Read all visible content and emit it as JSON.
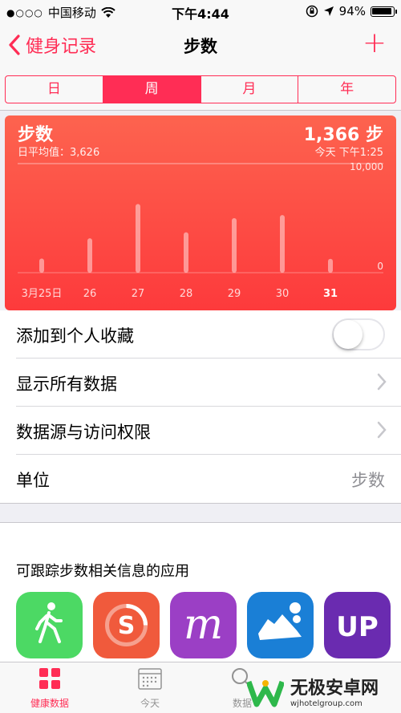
{
  "status_bar": {
    "carrier": "中国移动",
    "time": "下午4:44",
    "battery": "94%"
  },
  "nav": {
    "back_label": "健身记录",
    "title": "步数",
    "add_label": "+"
  },
  "segments": [
    {
      "label": "日",
      "active": false
    },
    {
      "label": "周",
      "active": true
    },
    {
      "label": "月",
      "active": false
    },
    {
      "label": "年",
      "active": false
    }
  ],
  "chart_card": {
    "title": "步数",
    "subtitle": "日平均值：3,626",
    "value": "1,366",
    "value_unit": "步",
    "time": "今天 下午1:25"
  },
  "chart_data": {
    "type": "bar",
    "categories": [
      "3月25日",
      "26",
      "27",
      "28",
      "29",
      "30",
      "31"
    ],
    "values": [
      1400,
      3400,
      6800,
      4000,
      5400,
      5700,
      1366
    ],
    "ylim": [
      0,
      10000
    ],
    "ytick_labels": [
      "10,000",
      "0"
    ],
    "highlight_category": "31",
    "color": "#ffffff"
  },
  "list": {
    "favorite_label": "添加到个人收藏",
    "favorite_on": false,
    "show_all_label": "显示所有数据",
    "sources_label": "数据源与访问权限",
    "unit_label": "单位",
    "unit_value": "步数"
  },
  "apps": {
    "heading": "可跟踪步数相关信息的应用",
    "items": [
      {
        "icon": "walking-figure-icon",
        "color": "#4cd964"
      },
      {
        "icon": "stepz-s-icon",
        "color": "#f05a3c"
      },
      {
        "icon": "moves-m-icon",
        "color": "#9b3fc5"
      },
      {
        "icon": "running-shoe-icon",
        "color": "#1a7fd6"
      },
      {
        "icon": "up-jawbone-icon",
        "color": "#6a2bb0"
      }
    ]
  },
  "tabbar": {
    "tabs": [
      {
        "label": "健康数据",
        "icon": "grid-icon",
        "active": true
      },
      {
        "label": "今天",
        "icon": "calendar-icon",
        "active": false
      },
      {
        "label": "数据",
        "icon": "search-icon",
        "active": false
      }
    ]
  },
  "watermark": {
    "title": "无极安卓网",
    "url": "wjhotelgroup.com"
  },
  "colors": {
    "accent": "#ff2d55",
    "chart_top": "#fd634f",
    "chart_bottom": "#fd3a3c"
  }
}
